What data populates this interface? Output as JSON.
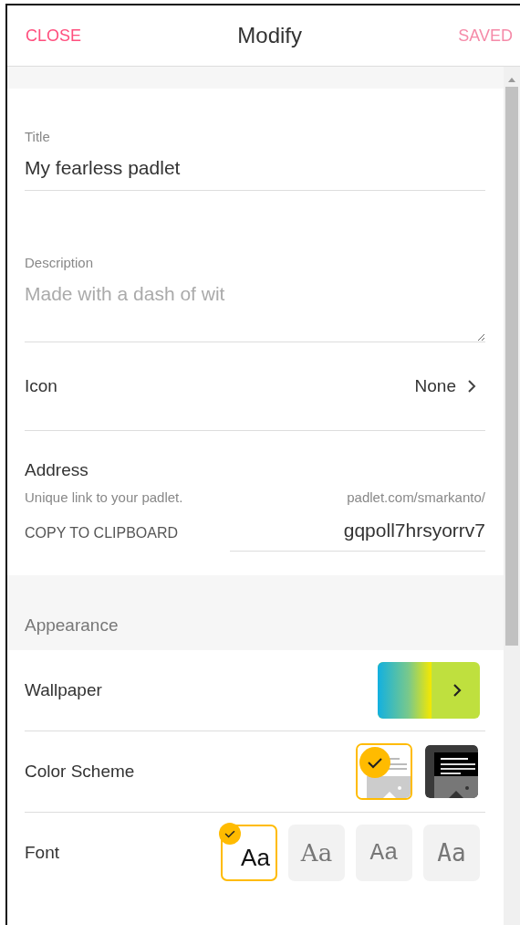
{
  "header": {
    "close": "CLOSE",
    "title": "Modify",
    "saved": {
      "label": "SAVED",
      "disabled": true
    }
  },
  "title_field": {
    "label": "Title",
    "value": "My fearless padlet"
  },
  "description_field": {
    "label": "Description",
    "placeholder": "Made with a dash of wit"
  },
  "icon_row": {
    "label": "Icon",
    "value": "None"
  },
  "address": {
    "label": "Address",
    "hint": "Unique link to your padlet.",
    "prefix": "padlet.com/smarkanto/",
    "copy": "COPY TO CLIPBOARD",
    "slug": "gqpoll7hrsyorrv7"
  },
  "appearance": {
    "heading": "Appearance",
    "wallpaper_label": "Wallpaper",
    "color_scheme_label": "Color Scheme",
    "color_schemes": [
      {
        "kind": "light",
        "selected": true
      },
      {
        "kind": "dark",
        "selected": false
      }
    ],
    "font_label": "Font",
    "fonts": [
      {
        "sample": "Aa",
        "kind": "sans",
        "selected": true
      },
      {
        "sample": "Aa",
        "kind": "serif",
        "selected": false
      },
      {
        "sample": "Aa",
        "kind": "mono",
        "selected": false
      },
      {
        "sample": "Aa",
        "kind": "typewriter",
        "selected": false
      }
    ]
  }
}
